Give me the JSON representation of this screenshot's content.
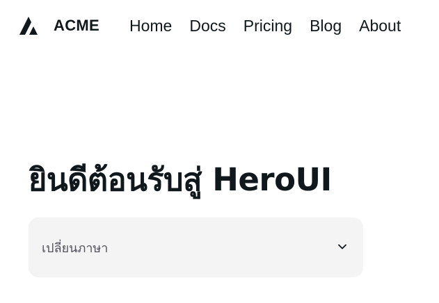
{
  "navbar": {
    "brand_name": "ACME",
    "brand_logo_icon": "acme-logo-icon",
    "links": [
      {
        "label": "Home"
      },
      {
        "label": "Docs"
      },
      {
        "label": "Pricing"
      },
      {
        "label": "Blog"
      },
      {
        "label": "About"
      }
    ]
  },
  "hero": {
    "title": "ยินดีต้อนรับสู่ HeroUI"
  },
  "language_select": {
    "label": "เปลี่ยนภาษา",
    "icon": "chevron-down-icon"
  },
  "colors": {
    "text": "#11181c",
    "select_background": "#f4f4f5",
    "select_label": "#52525b",
    "page_background": "#ffffff"
  }
}
